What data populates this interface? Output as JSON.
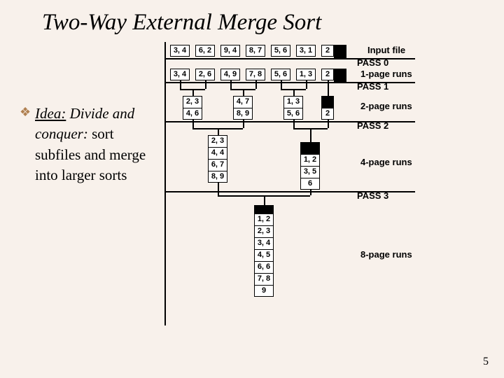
{
  "title": "Two-Way External Merge Sort",
  "bullet_icon": "❖",
  "idea_underline": "Idea:",
  "idea_rest": " Divide and conquer:",
  "idea_tail": " sort subfiles and merge into larger sorts",
  "row0": [
    "3, 4",
    "6, 2",
    "9, 4",
    "8, 7",
    "5, 6",
    "3, 1",
    "2"
  ],
  "row1": [
    "3, 4",
    "2, 6",
    "4, 9",
    "7, 8",
    "5, 6",
    "1, 3",
    "2"
  ],
  "pass1_left": [
    "2, 3",
    "4, 6"
  ],
  "pass1_mid": [
    "4, 7",
    "8, 9"
  ],
  "pass1_right": [
    "1, 3",
    "5, 6"
  ],
  "pass1_single": "2",
  "pass2_left": [
    "2, 3",
    "4, 4",
    "6, 7",
    "8, 9"
  ],
  "pass2_right": [
    "1, 2",
    "3, 5",
    "6"
  ],
  "final": [
    "1, 2",
    "2, 3",
    "3, 4",
    "4, 5",
    "6, 6",
    "7, 8",
    "9"
  ],
  "labels": {
    "input": "Input file",
    "p0": "PASS 0",
    "r1": "1-page runs",
    "p1": "PASS 1",
    "r2": "2-page runs",
    "p2": "PASS 2",
    "r4": "4-page runs",
    "p3": "PASS 3",
    "r8": "8-page runs"
  },
  "slide_number": "5"
}
